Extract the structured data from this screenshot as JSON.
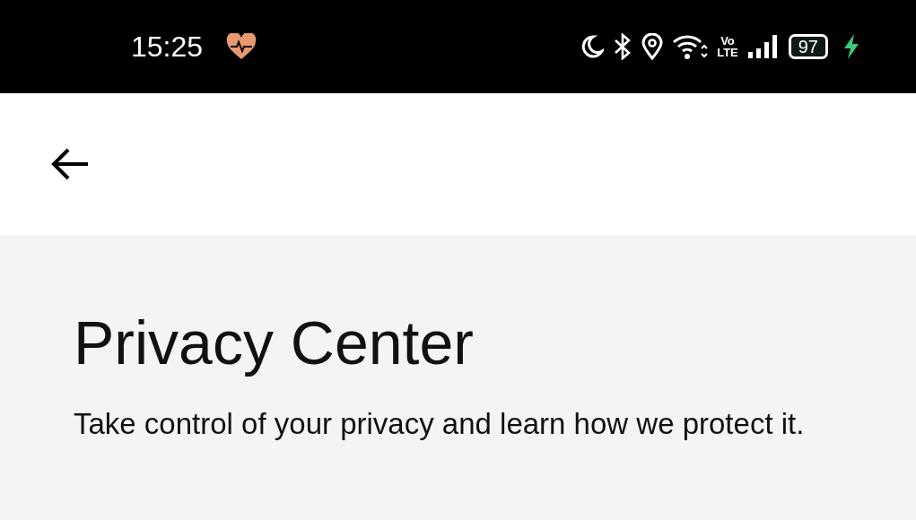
{
  "status_bar": {
    "time": "15:25",
    "volte": [
      "Vo",
      "LTE"
    ],
    "battery": "97",
    "charging": true
  },
  "header": {
    "back": true
  },
  "page": {
    "title": "Privacy Center",
    "subtitle": "Take control of your privacy and learn how we protect it."
  }
}
